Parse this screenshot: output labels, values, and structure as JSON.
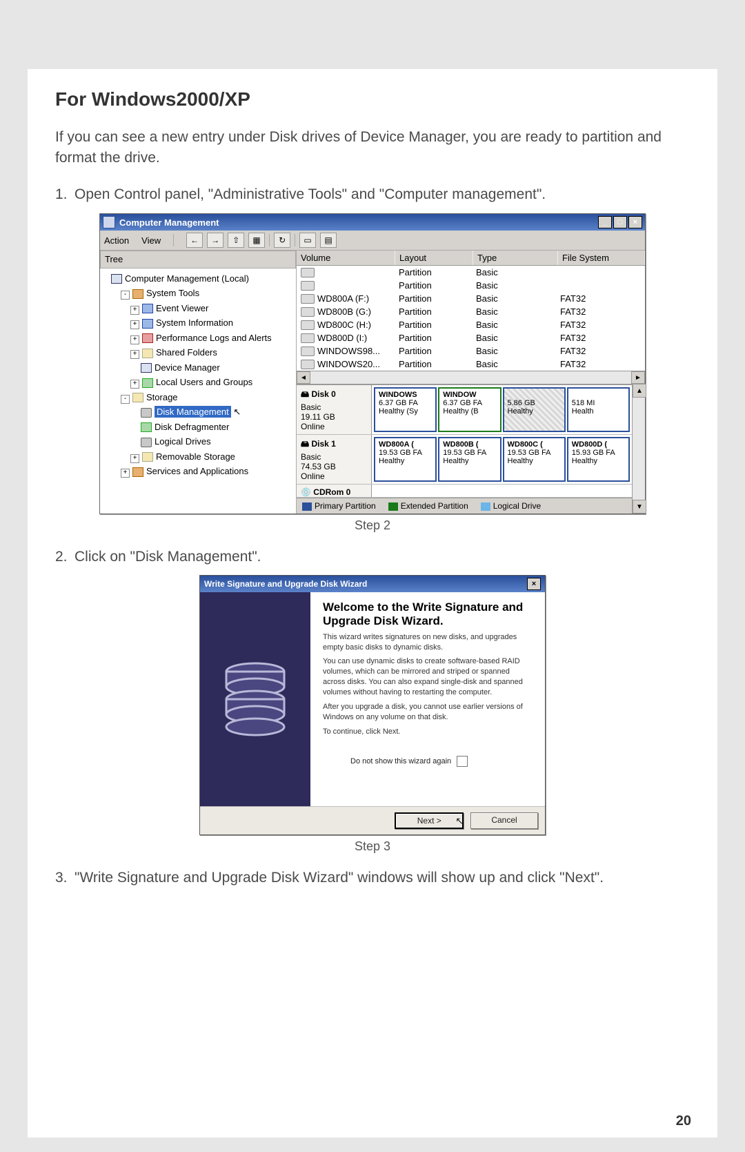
{
  "page": {
    "heading": "For Windows2000/XP",
    "intro": "If you can see a new entry under Disk drives of Device Manager, you are ready to partition and format the drive.",
    "steps": [
      "Open Control panel, \"Administrative Tools\" and \"Computer management\".",
      "Click on \"Disk Management\".",
      "\"Write Signature and Upgrade Disk Wizard\" windows will show up and click \"Next\"."
    ],
    "caption2": "Step 2",
    "caption3": "Step 3",
    "page_number": "20"
  },
  "cm": {
    "title": "Computer Management",
    "menu": {
      "action": "Action",
      "view": "View"
    },
    "toolbar_arrows": {
      "back": "←",
      "fwd": "→"
    },
    "tree_header": "Tree",
    "tree": {
      "root": "Computer Management (Local)",
      "system_tools": "System Tools",
      "event_viewer": "Event Viewer",
      "system_info": "System Information",
      "perf_logs": "Performance Logs and Alerts",
      "shared": "Shared Folders",
      "devmgr": "Device Manager",
      "local_users": "Local Users and Groups",
      "storage": "Storage",
      "disk_mgmt": "Disk Management",
      "defrag": "Disk Defragmenter",
      "logical": "Logical Drives",
      "removable": "Removable Storage",
      "services": "Services and Applications"
    },
    "columns": {
      "volume": "Volume",
      "layout": "Layout",
      "type": "Type",
      "fs": "File System"
    },
    "volumes": [
      {
        "vol": "",
        "layout": "Partition",
        "type": "Basic",
        "fs": ""
      },
      {
        "vol": "",
        "layout": "Partition",
        "type": "Basic",
        "fs": ""
      },
      {
        "vol": "WD800A (F:)",
        "layout": "Partition",
        "type": "Basic",
        "fs": "FAT32"
      },
      {
        "vol": "WD800B (G:)",
        "layout": "Partition",
        "type": "Basic",
        "fs": "FAT32"
      },
      {
        "vol": "WD800C (H:)",
        "layout": "Partition",
        "type": "Basic",
        "fs": "FAT32"
      },
      {
        "vol": "WD800D (I:)",
        "layout": "Partition",
        "type": "Basic",
        "fs": "FAT32"
      },
      {
        "vol": "WINDOWS98...",
        "layout": "Partition",
        "type": "Basic",
        "fs": "FAT32"
      },
      {
        "vol": "WINDOWS20...",
        "layout": "Partition",
        "type": "Basic",
        "fs": "FAT32"
      }
    ],
    "disks": [
      {
        "name": "Disk 0",
        "type": "Basic",
        "size": "19.11 GB",
        "status": "Online",
        "parts": [
          {
            "label": "WINDOWS",
            "size": "6.37 GB FA",
            "status": "Healthy (Sy"
          },
          {
            "label": "WINDOW",
            "size": "6.37 GB FA",
            "status": "Healthy (B"
          },
          {
            "label": "",
            "size": "5.86 GB",
            "status": "Healthy"
          },
          {
            "label": "",
            "size": "518 MI",
            "status": "Health"
          }
        ]
      },
      {
        "name": "Disk 1",
        "type": "Basic",
        "size": "74.53 GB",
        "status": "Online",
        "parts": [
          {
            "label": "WD800A (",
            "size": "19.53 GB FA",
            "status": "Healthy"
          },
          {
            "label": "WD800B (",
            "size": "19.53 GB FA",
            "status": "Healthy"
          },
          {
            "label": "WD800C (",
            "size": "19.53 GB FA",
            "status": "Healthy"
          },
          {
            "label": "WD800D (",
            "size": "15.93 GB FA",
            "status": "Healthy"
          }
        ]
      }
    ],
    "cdrow": "CDRom 0",
    "legend": {
      "pp": "Primary Partition",
      "ep": "Extended Partition",
      "ld": "Logical Drive"
    }
  },
  "wiz": {
    "title": "Write Signature and Upgrade Disk Wizard",
    "heading": "Welcome to the Write Signature and Upgrade Disk Wizard.",
    "p1": "This wizard writes signatures on new disks, and upgrades empty basic disks to dynamic disks.",
    "p2": "You can use dynamic disks to create software-based RAID volumes, which can be mirrored and striped or spanned across disks. You can also expand single-disk and spanned volumes without having to restarting the computer.",
    "p3": "After you upgrade a disk, you cannot use earlier versions of Windows on any volume on that disk.",
    "p4": "To continue, click Next.",
    "check": "Do not show this wizard again",
    "next": "Next >",
    "cancel": "Cancel"
  }
}
